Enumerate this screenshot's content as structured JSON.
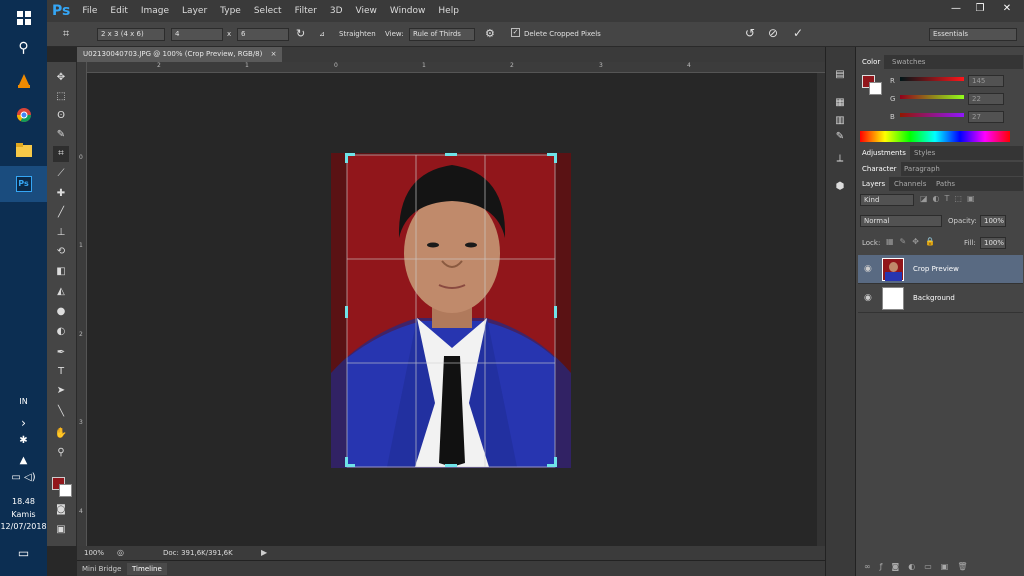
{
  "taskbar": {
    "lang": "IN",
    "time": "18.48",
    "day": "Kamis",
    "date": "12/07/2018"
  },
  "app": {
    "logo": "Ps",
    "menu": [
      "File",
      "Edit",
      "Image",
      "Layer",
      "Type",
      "Select",
      "Filter",
      "3D",
      "View",
      "Window",
      "Help"
    ],
    "workspace": "Essentials"
  },
  "options": {
    "ratio_preset": "2 x 3 (4 x 6)",
    "width": "4",
    "x_sep": "x",
    "height": "6",
    "straighten": "Straighten",
    "view_label": "View:",
    "view_value": "Rule of Thirds",
    "delete_cropped": "Delete Cropped Pixels",
    "delete_cropped_checked": true
  },
  "document": {
    "tab_title": "U02130040703.JPG @ 100% (Crop Preview, RGB/8)",
    "ruler_h": [
      "2",
      "1",
      "0",
      "1",
      "2",
      "3",
      "4"
    ],
    "ruler_v": [
      "0",
      "1",
      "2",
      "3",
      "4"
    ],
    "zoom": "100%",
    "doc_info": "Doc: 391,6K/391,6K"
  },
  "bottom_tabs": [
    "Mini Bridge",
    "Timeline"
  ],
  "color_panel": {
    "tabs": [
      "Color",
      "Swatches"
    ],
    "r_label": "R",
    "r_value": "145",
    "g_label": "G",
    "g_value": "22",
    "b_label": "B",
    "b_value": "27",
    "fg_color": "#91161b"
  },
  "adjustments_tabs": [
    "Adjustments",
    "Styles"
  ],
  "character_tabs": [
    "Character",
    "Paragraph"
  ],
  "layers_panel": {
    "tabs": [
      "Layers",
      "Channels",
      "Paths"
    ],
    "filter_kind": "Kind",
    "blend_mode": "Normal",
    "opacity_label": "Opacity:",
    "opacity_value": "100%",
    "lock_label": "Lock:",
    "fill_label": "Fill:",
    "fill_value": "100%",
    "layers": [
      {
        "name": "Crop Preview",
        "selected": true
      },
      {
        "name": "Background",
        "selected": false
      }
    ]
  }
}
